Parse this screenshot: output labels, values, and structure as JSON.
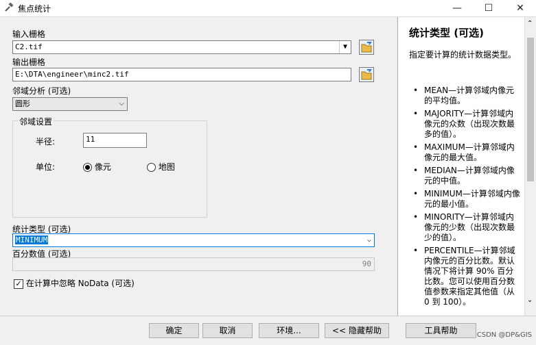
{
  "window": {
    "title": "焦点统计",
    "minimize": "—",
    "maximize": "☐",
    "close": "✕"
  },
  "form": {
    "input_raster_label": "输入栅格",
    "input_raster_value": "C2.tif",
    "output_raster_label": "输出栅格",
    "output_raster_value": "E:\\DTA\\engineer\\minc2.tif",
    "neighborhood_label": "邻域分析 (可选)",
    "neighborhood_value": "圆形",
    "neighborhood_settings_label": "邻域设置",
    "radius_label": "半径:",
    "radius_value": "11",
    "units_label": "单位:",
    "unit_cell": "像元",
    "unit_map": "地图",
    "statistics_type_label": "统计类型 (可选)",
    "statistics_type_value": "MINIMUM",
    "percentile_label": "百分数值 (可选)",
    "percentile_value": "90",
    "ignore_nodata_label": "在计算中忽略 NoData (可选)"
  },
  "help": {
    "title": "统计类型 (可选)",
    "description": "指定要计算的统计数据类型。",
    "items": [
      "MEAN—计算邻域内像元的平均值。",
      "MAJORITY—计算邻域内像元的众数（出现次数最多的值）。",
      "MAXIMUM—计算邻域内像元的最大值。",
      "MEDIAN—计算邻域内像元的中值。",
      "MINIMUM—计算邻域内像元的最小值。",
      "MINORITY—计算邻域内像元的少数（出现次数最少的值）。",
      "PERCENTILE—计算邻域内像元的百分比数。默认情况下将计算 90% 百分比数。您可以使用百分数值参数来指定其他值（从 0 到 100）。"
    ]
  },
  "buttons": {
    "ok": "确定",
    "cancel": "取消",
    "environments": "环境...",
    "hide_help": "<< 隐藏帮助",
    "tool_help": "工具帮助"
  },
  "watermark": "CSDN @DP&GIS",
  "icons": {
    "app": "hammer-icon",
    "folder": "folder-open-icon"
  }
}
